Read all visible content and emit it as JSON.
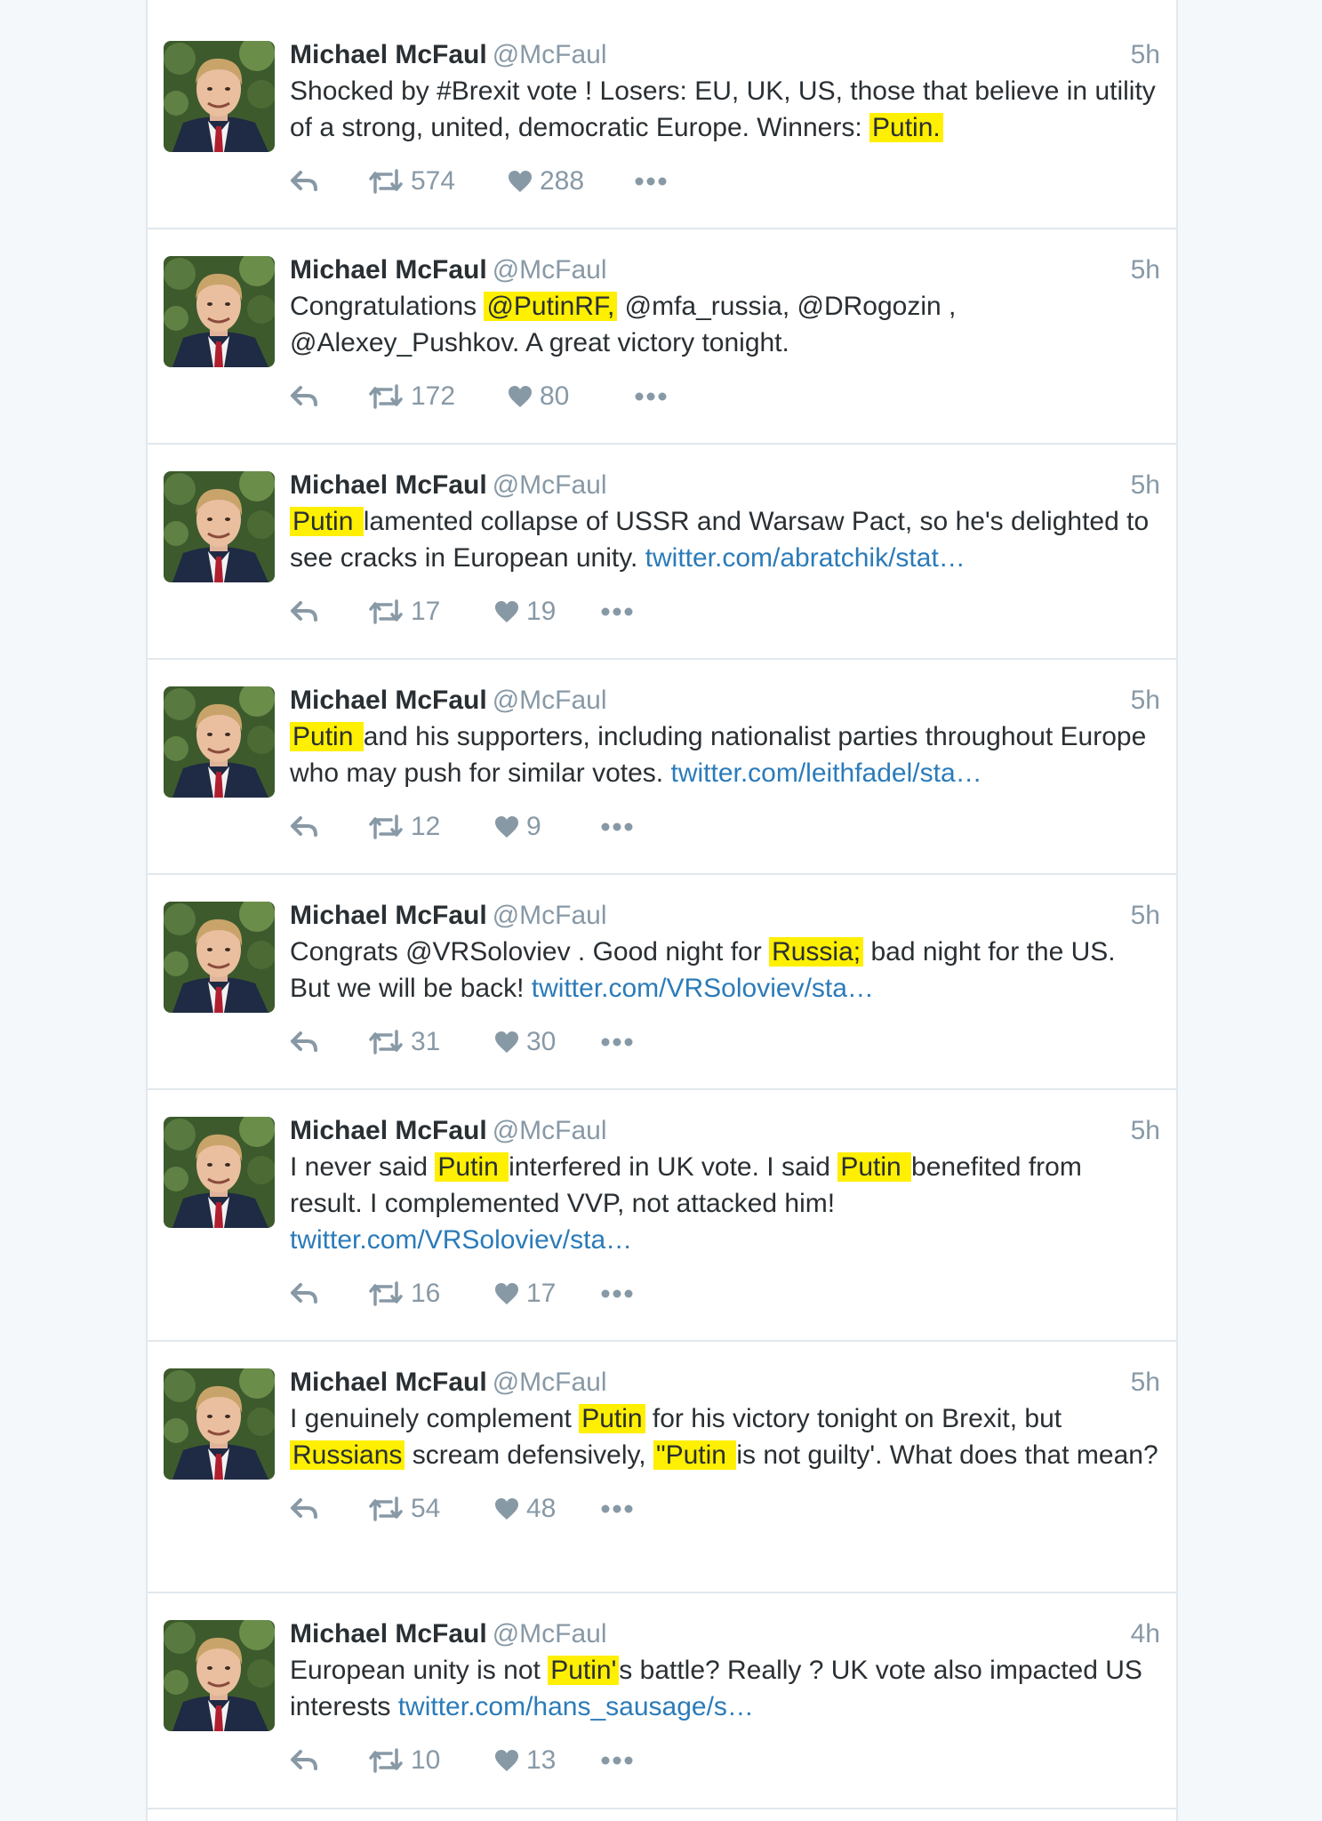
{
  "tweets": [
    {
      "name": "Michael McFaul",
      "handle": "@McFaul",
      "time": "5h",
      "segments": [
        {
          "t": "Shocked by #Brexit vote !  Losers: EU, UK, US, those that believe in utility of a strong, united, democratic Europe.  Winners: "
        },
        {
          "t": "Putin.",
          "hl": true
        }
      ],
      "retweets": "574",
      "likes": "288"
    },
    {
      "name": "Michael McFaul",
      "handle": "@McFaul",
      "time": "5h",
      "segments": [
        {
          "t": "Congratulations "
        },
        {
          "t": "@PutinRF,",
          "hl": true
        },
        {
          "t": " @mfa_russia,  @DRogozin , @Alexey_Pushkov. A great victory tonight."
        }
      ],
      "retweets": "172",
      "likes": "80"
    },
    {
      "name": "Michael McFaul",
      "handle": "@McFaul",
      "time": "5h",
      "segments": [
        {
          "t": "Putin ",
          "hl": true
        },
        {
          "t": "lamented collapse of USSR and Warsaw Pact, so he's delighted to see cracks in European unity. "
        },
        {
          "t": "twitter.com/abratchik/stat…",
          "link": true
        }
      ],
      "retweets": "17",
      "likes": "19"
    },
    {
      "name": "Michael McFaul",
      "handle": "@McFaul",
      "time": "5h",
      "segments": [
        {
          "t": "Putin ",
          "hl": true
        },
        {
          "t": "and his supporters, including nationalist parties throughout Europe who may push for similar votes. "
        },
        {
          "t": "twitter.com/leithfadel/sta…",
          "link": true
        }
      ],
      "retweets": "12",
      "likes": "9"
    },
    {
      "name": "Michael McFaul",
      "handle": "@McFaul",
      "time": "5h",
      "segments": [
        {
          "t": "Congrats @VRSoloviev .  Good night for "
        },
        {
          "t": "Russia;",
          "hl": true
        },
        {
          "t": " bad night for the US. But we will be back! "
        },
        {
          "t": "twitter.com/VRSoloviev/sta…",
          "link": true
        }
      ],
      "retweets": "31",
      "likes": "30"
    },
    {
      "name": "Michael McFaul",
      "handle": "@McFaul",
      "time": "5h",
      "segments": [
        {
          "t": "I never said "
        },
        {
          "t": "Putin ",
          "hl": true
        },
        {
          "t": "interfered in UK vote. I said "
        },
        {
          "t": "Putin ",
          "hl": true
        },
        {
          "t": "benefited from result.  I complemented VVP, not attacked him! "
        },
        {
          "t": "twitter.com/VRSoloviev/sta…",
          "link": true
        }
      ],
      "retweets": "16",
      "likes": "17"
    },
    {
      "name": "Michael McFaul",
      "handle": "@McFaul",
      "time": "5h",
      "segments": [
        {
          "t": "I genuinely complement "
        },
        {
          "t": "Putin",
          "hl": true
        },
        {
          "t": " for his victory tonight on Brexit, but "
        },
        {
          "t": "Russians",
          "hl": true
        },
        {
          "t": " scream defensively, "
        },
        {
          "t": "\"Putin ",
          "hl": true
        },
        {
          "t": "is not guilty'. What does that mean?"
        }
      ],
      "retweets": "54",
      "likes": "48"
    },
    {
      "name": "Michael McFaul",
      "handle": "@McFaul",
      "time": "4h",
      "segments": [
        {
          "t": "European unity is not "
        },
        {
          "t": "Putin'",
          "hl": true
        },
        {
          "t": "s battle? Really ? UK vote also impacted US interests "
        },
        {
          "t": "twitter.com/hans_sausage/s…",
          "link": true
        }
      ],
      "retweets": "10",
      "likes": "13"
    }
  ]
}
